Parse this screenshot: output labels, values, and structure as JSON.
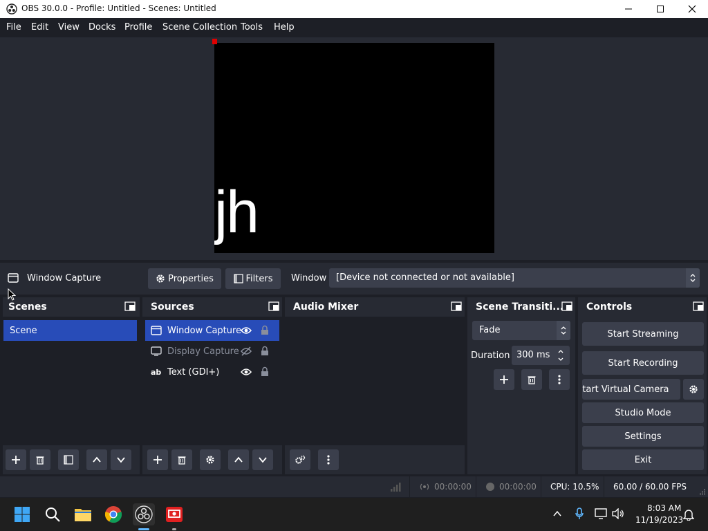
{
  "window": {
    "title": "OBS 30.0.0 - Profile: Untitled - Scenes: Untitled"
  },
  "menu": [
    "File",
    "Edit",
    "View",
    "Docks",
    "Profile",
    "Scene Collection",
    "Tools",
    "Help"
  ],
  "preview": {
    "text": "jh"
  },
  "source_toolbar": {
    "source_name": "Window Capture",
    "properties_label": "Properties",
    "filters_label": "Filters",
    "window_label": "Window",
    "window_value": "[Device not connected or not available]"
  },
  "scenes": {
    "title": "Scenes",
    "items": [
      "Scene"
    ]
  },
  "sources": {
    "title": "Sources",
    "items": [
      {
        "name": "Window Capture",
        "visible": true,
        "selected": true
      },
      {
        "name": "Display Capture",
        "visible": false,
        "selected": false
      },
      {
        "name": "Text (GDI+)",
        "visible": true,
        "selected": false
      }
    ]
  },
  "audio_mixer": {
    "title": "Audio Mixer"
  },
  "transitions": {
    "title": "Scene Transiti...",
    "selected": "Fade",
    "duration_label": "Duration",
    "duration_value": "300 ms"
  },
  "controls": {
    "title": "Controls",
    "start_streaming": "Start Streaming",
    "start_recording": "Start Recording",
    "start_virtual_camera": "Start Virtual Camera",
    "studio_mode": "Studio Mode",
    "settings": "Settings",
    "exit": "Exit"
  },
  "status": {
    "stream_time": "00:00:00",
    "record_time": "00:00:00",
    "cpu": "CPU: 10.5%",
    "fps": "60.00 / 60.00 FPS"
  },
  "taskbar": {
    "time": "8:03 AM",
    "date": "11/19/2023"
  },
  "colors": {
    "accent": "#284cb8",
    "panel": "#272a33",
    "background": "#1d1f26",
    "button": "#3b3f4c"
  }
}
